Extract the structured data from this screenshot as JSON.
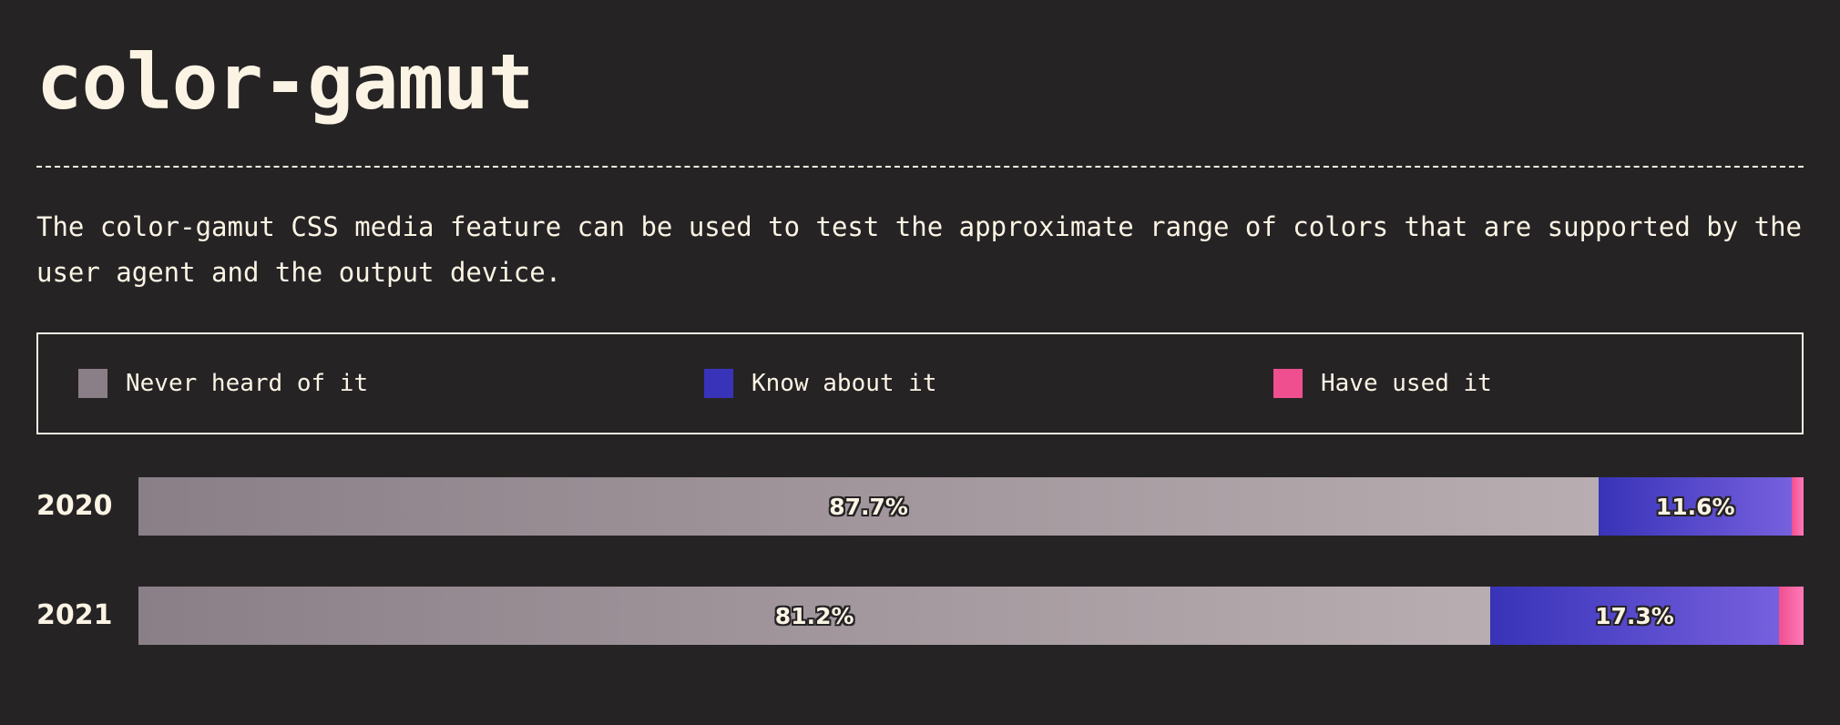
{
  "title": "color-gamut",
  "description": "The color-gamut CSS media feature can be used to test the approximate range of colors that are supported by the user agent and the output device.",
  "legend": [
    {
      "key": "never",
      "label": "Never heard of it",
      "color": "#8a7f87"
    },
    {
      "key": "know",
      "label": "Know about it",
      "color": "#3833b8"
    },
    {
      "key": "used",
      "label": "Have used it",
      "color": "#f04f8f"
    }
  ],
  "chart_data": {
    "type": "bar",
    "orientation": "horizontal",
    "stacked": true,
    "categories": [
      "2020",
      "2021"
    ],
    "series": [
      {
        "name": "Never heard of it",
        "values": [
          87.7,
          81.2
        ]
      },
      {
        "name": "Know about it",
        "values": [
          11.6,
          17.3
        ]
      },
      {
        "name": "Have used it",
        "values": [
          0.7,
          1.5
        ]
      }
    ],
    "data_labels": [
      [
        "87.7%",
        "11.6%",
        ""
      ],
      [
        "81.2%",
        "17.3%",
        ""
      ]
    ],
    "xlim": [
      0,
      100
    ],
    "legend_position": "top"
  }
}
